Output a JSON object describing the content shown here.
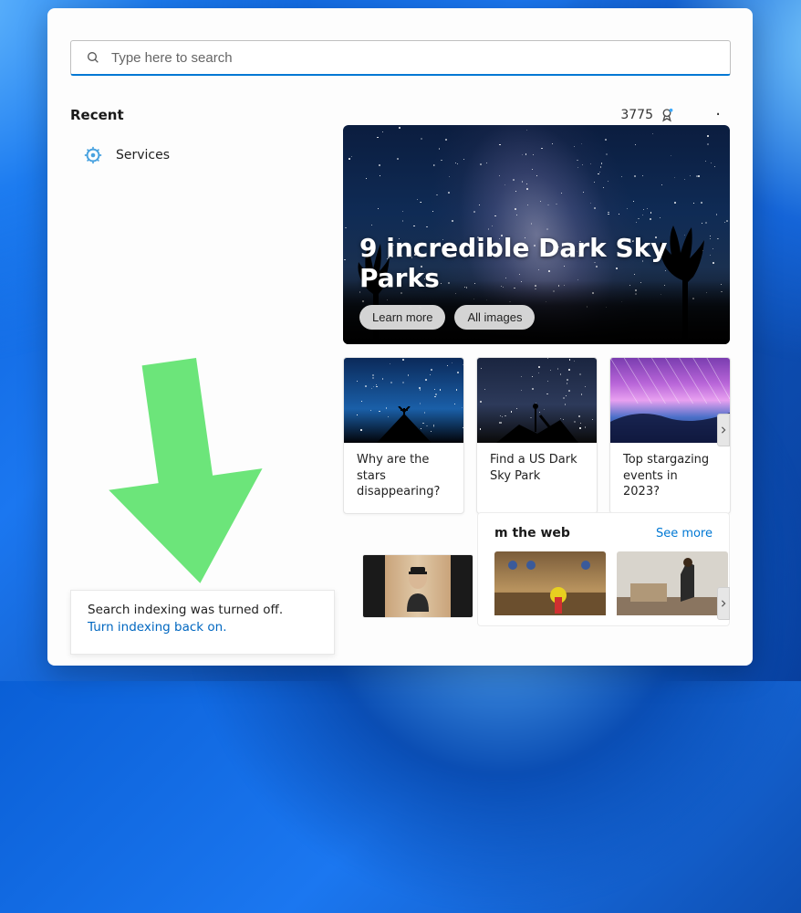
{
  "search": {
    "placeholder": "Type here to search"
  },
  "rewards": {
    "points": "3775"
  },
  "recent": {
    "header": "Recent",
    "items": [
      {
        "label": "Services",
        "icon": "services-icon"
      }
    ]
  },
  "notice": {
    "message": "Search indexing was turned off.",
    "link": "Turn indexing back on."
  },
  "hero": {
    "title": "9 incredible Dark Sky Parks",
    "learn_more": "Learn more",
    "all_images": "All images"
  },
  "cards": [
    {
      "title": "Why are the stars disappearing?"
    },
    {
      "title": "Find a US Dark Sky Park"
    },
    {
      "title": "Top stargazing events in 2023?"
    }
  ],
  "web": {
    "header": "m the web",
    "see_more": "See more"
  }
}
